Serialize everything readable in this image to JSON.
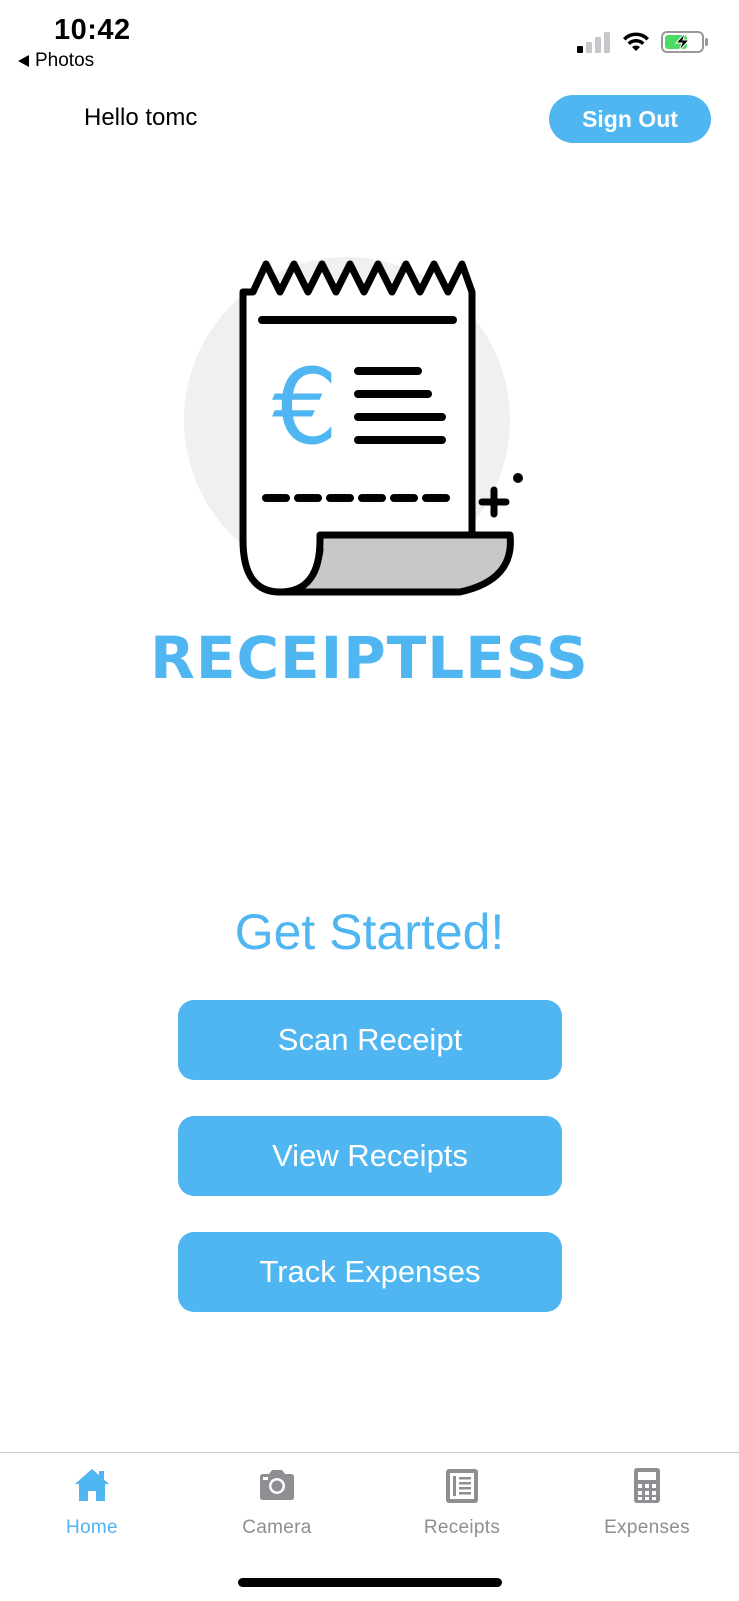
{
  "status_bar": {
    "time": "10:42",
    "back_label": "Photos"
  },
  "header": {
    "greeting": "Hello tomc",
    "sign_out_label": "Sign Out"
  },
  "logo": {
    "brand": "RECEIPTLESS",
    "currency_symbol": "€"
  },
  "main": {
    "heading": "Get Started!",
    "buttons": [
      {
        "label": "Scan Receipt"
      },
      {
        "label": "View Receipts"
      },
      {
        "label": "Track Expenses"
      }
    ]
  },
  "tabbar": {
    "tabs": [
      {
        "label": "Home",
        "icon": "home-icon",
        "active": true
      },
      {
        "label": "Camera",
        "icon": "camera-icon",
        "active": false
      },
      {
        "label": "Receipts",
        "icon": "receipts-icon",
        "active": false
      },
      {
        "label": "Expenses",
        "icon": "calculator-icon",
        "active": false
      }
    ]
  },
  "colors": {
    "accent": "#4fb6f1",
    "tab_inactive": "#8e8e93",
    "battery_green": "#4cd964"
  }
}
